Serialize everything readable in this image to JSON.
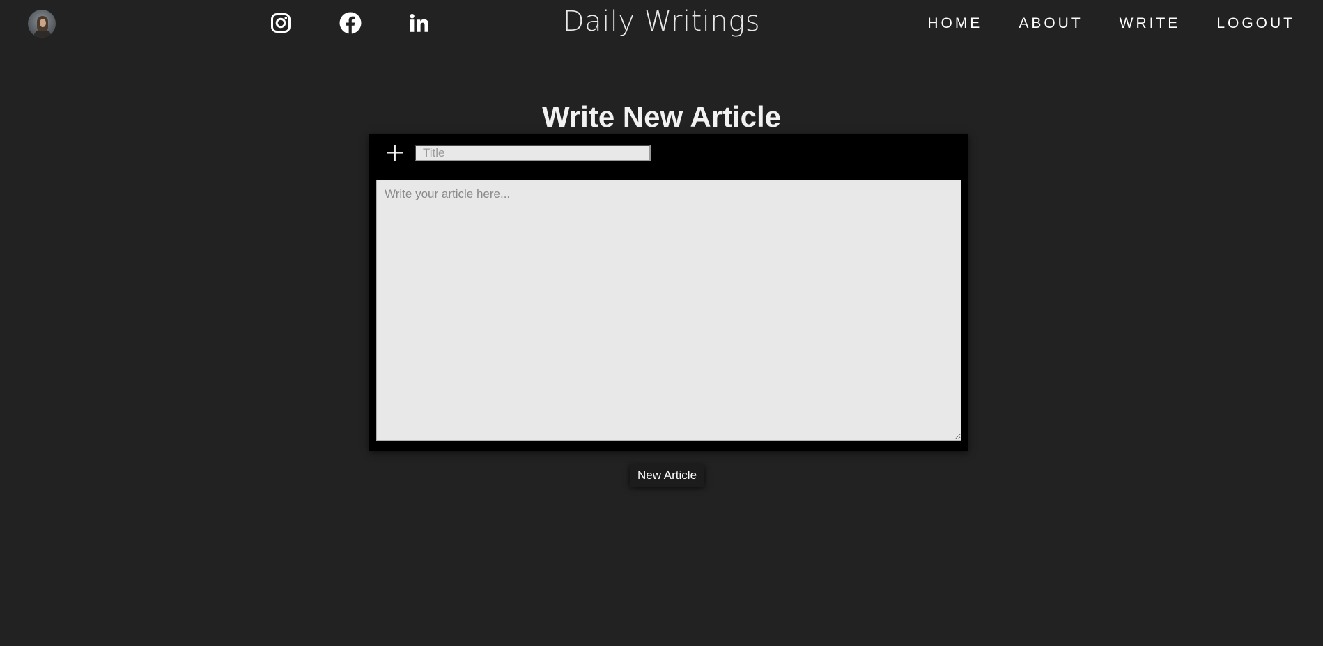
{
  "header": {
    "brand": "Daily Writings",
    "social": [
      {
        "name": "instagram-icon"
      },
      {
        "name": "facebook-icon"
      },
      {
        "name": "linkedin-icon"
      }
    ],
    "nav": [
      "HOME",
      "ABOUT",
      "WRITE",
      "LOGOUT"
    ]
  },
  "main": {
    "page_title": "Write New Article",
    "add_button_label": "+",
    "title_placeholder": "Title",
    "body_placeholder": "Write your article here...",
    "submit_label": "New Article"
  },
  "colors": {
    "background": "#222222",
    "editor_background": "#000000",
    "field_background": "#e8e8e8",
    "text": "#ffffff"
  }
}
